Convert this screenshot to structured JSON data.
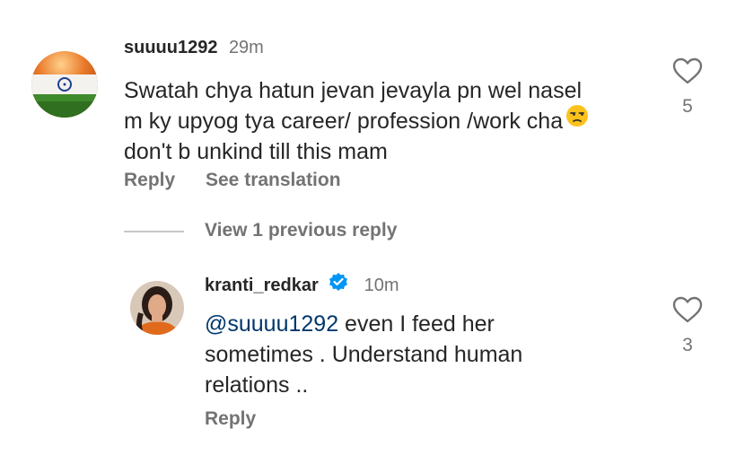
{
  "comments": [
    {
      "username": "suuuu1292",
      "time": "29m",
      "text": "Swatah chya hatun jevan jevayla pn wel nasel",
      "text_line2": "m ky upyog tya career/ profession /work cha",
      "text_line3": "don't b unkind till this mam",
      "emoji": "unamused-face-icon",
      "likes": "5",
      "reply_label": "Reply",
      "translate_label": "See translation"
    }
  ],
  "thread": {
    "view_replies_label": "View 1 previous reply"
  },
  "reply": {
    "username": "kranti_redkar",
    "verified": true,
    "time": "10m",
    "mention": "@suuuu1292",
    "text_line1": " even I feed her",
    "text_line2": "sometimes . Understand human",
    "text_line3": "relations ..",
    "likes": "3",
    "reply_label": "Reply"
  },
  "colors": {
    "text": "#262626",
    "secondary": "#737373",
    "mention": "#00376b",
    "verified": "#0095f6"
  }
}
